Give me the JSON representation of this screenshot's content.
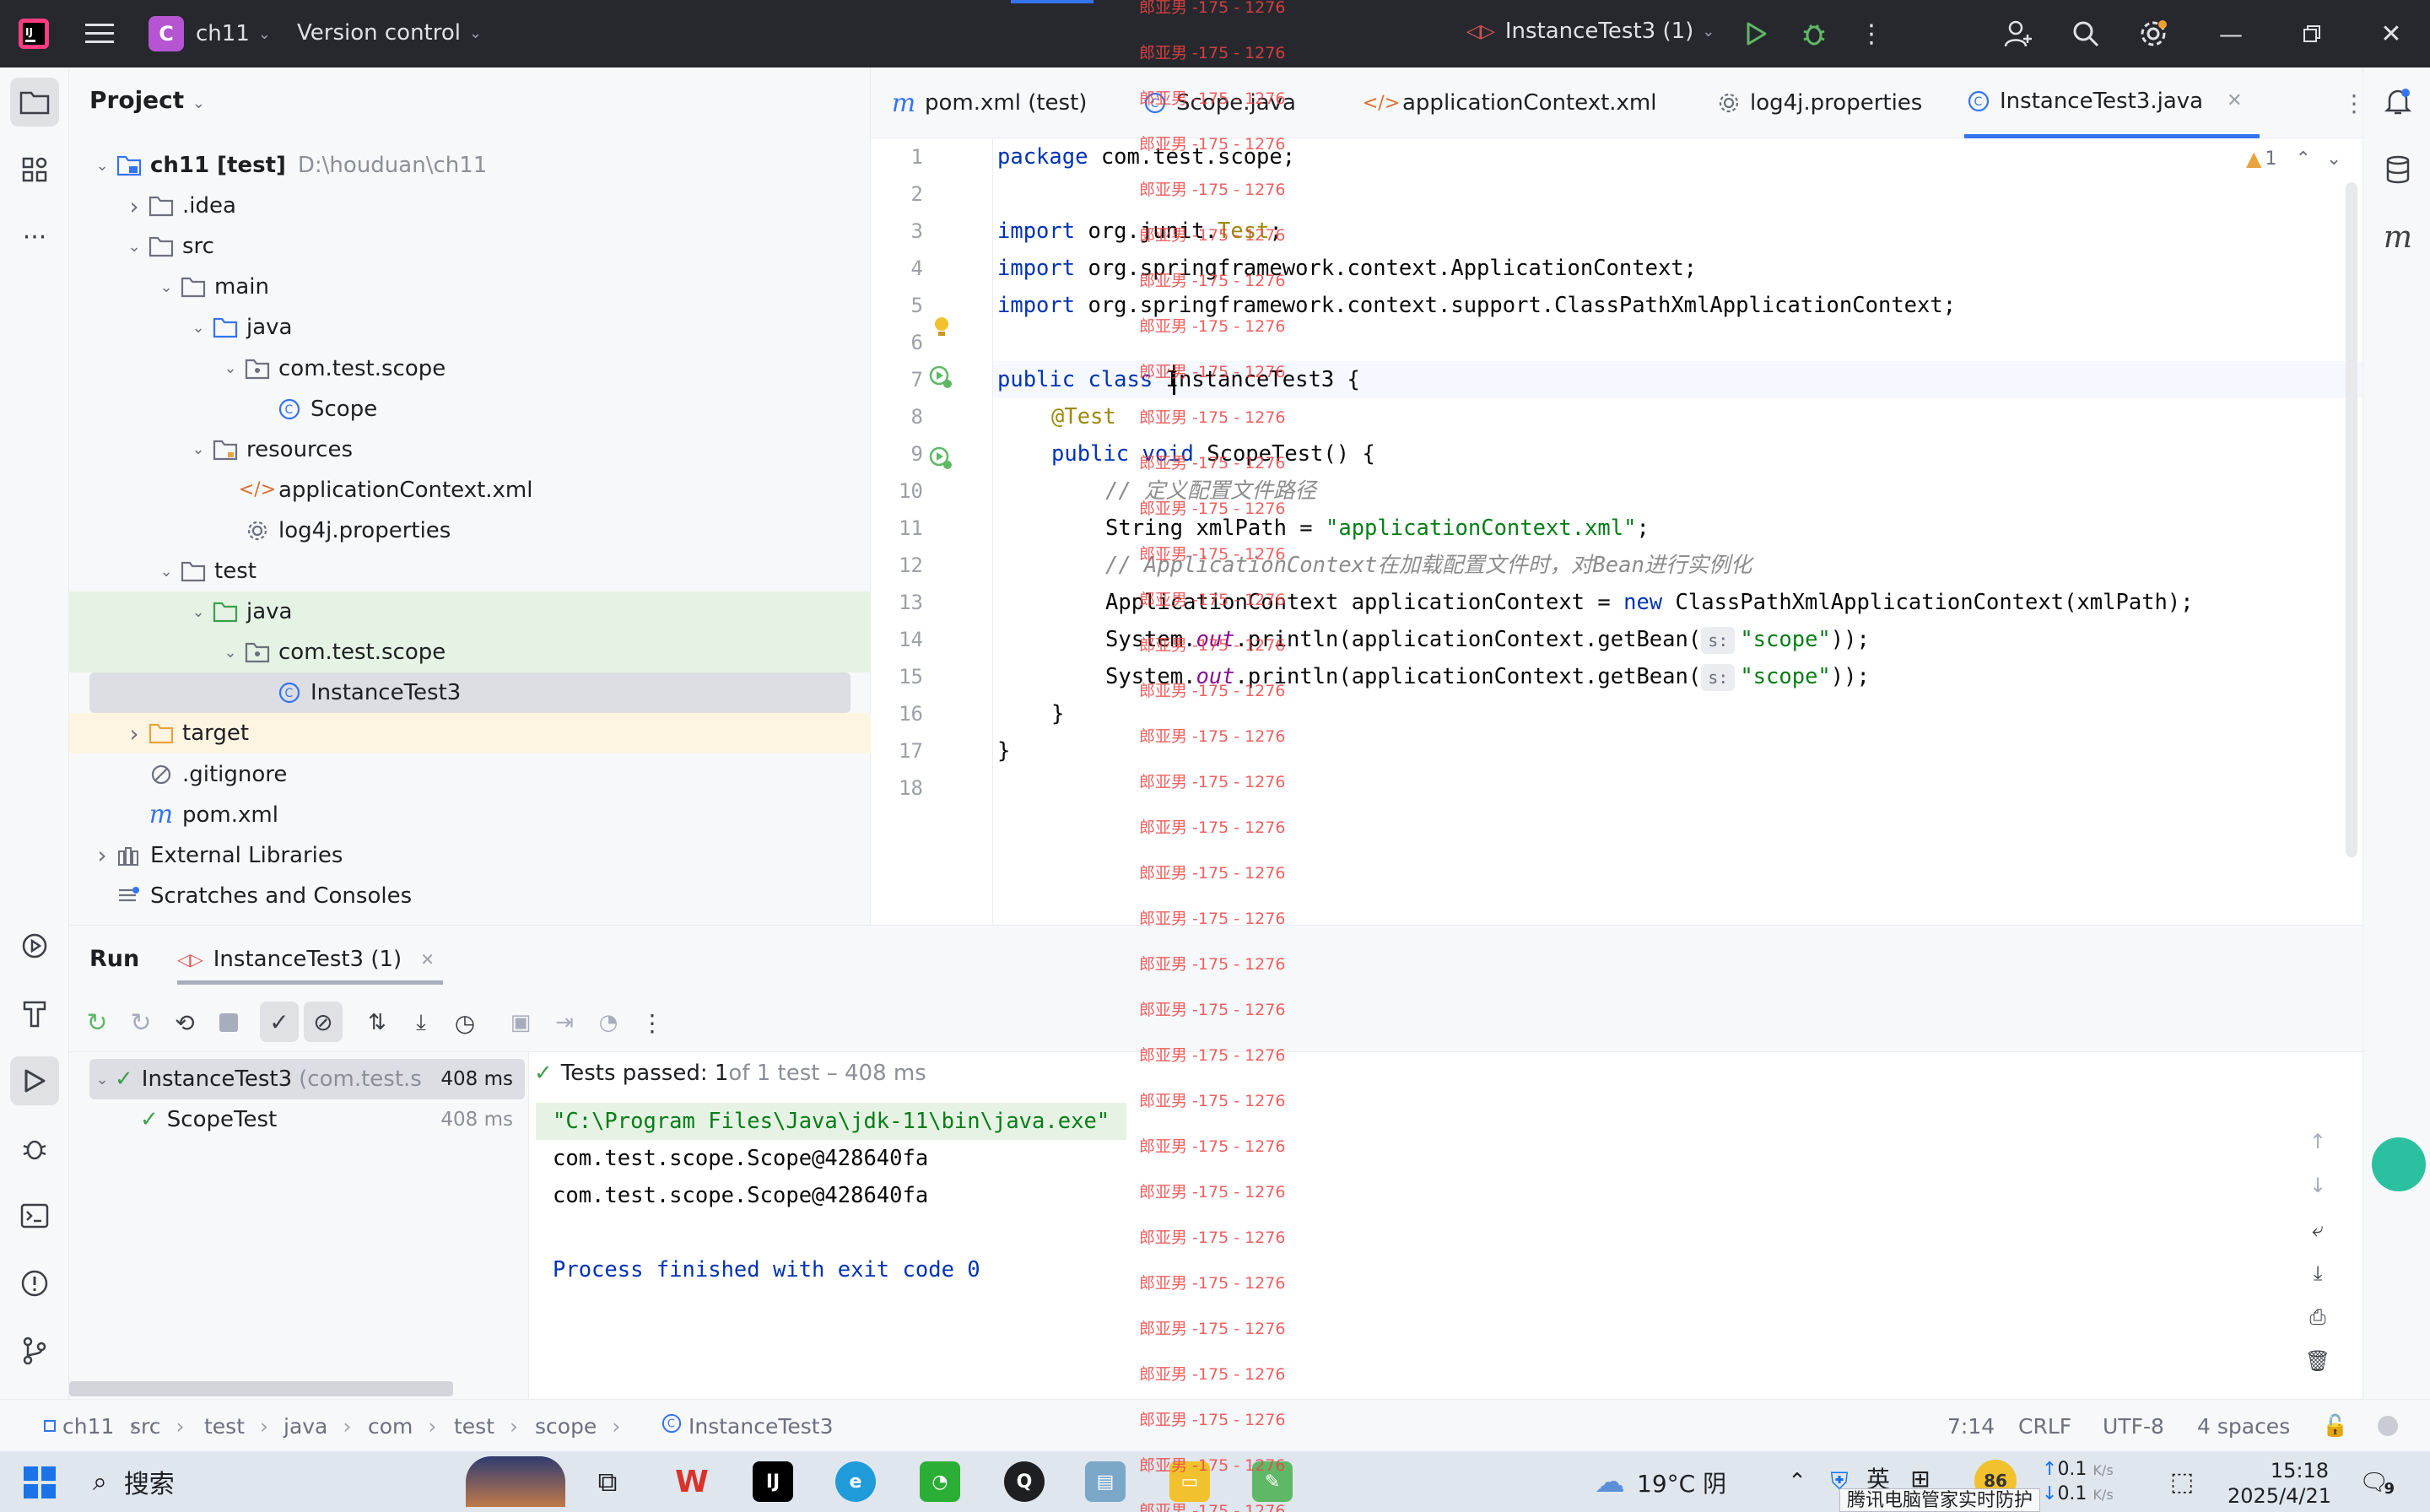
{
  "titlebar": {
    "project_badge": "C",
    "project_name": "ch11",
    "vcs_label": "Version control",
    "run_config": "InstanceTest3 (1)"
  },
  "project_panel": {
    "title": "Project",
    "tree": [
      {
        "label": "ch11 [test]",
        "extra": "D:\\houduan\\ch11",
        "depth": 0,
        "icon": "module-folder-icon",
        "arrow": "down"
      },
      {
        "label": ".idea",
        "depth": 1,
        "icon": "folder-icon",
        "arrow": "right"
      },
      {
        "label": "src",
        "depth": 1,
        "icon": "folder-icon",
        "arrow": "down"
      },
      {
        "label": "main",
        "depth": 2,
        "icon": "folder-icon",
        "arrow": "down"
      },
      {
        "label": "java",
        "depth": 3,
        "icon": "source-folder-icon",
        "arrow": "down"
      },
      {
        "label": "com.test.scope",
        "depth": 4,
        "icon": "package-icon",
        "arrow": "down"
      },
      {
        "label": "Scope",
        "depth": 5,
        "icon": "class-icon",
        "arrow": ""
      },
      {
        "label": "resources",
        "depth": 3,
        "icon": "resources-folder-icon",
        "arrow": "down"
      },
      {
        "label": "applicationContext.xml",
        "depth": 4,
        "icon": "xml-file-icon",
        "arrow": ""
      },
      {
        "label": "log4j.properties",
        "depth": 4,
        "icon": "properties-file-icon",
        "arrow": ""
      },
      {
        "label": "test",
        "depth": 2,
        "icon": "folder-icon",
        "arrow": "down"
      },
      {
        "label": "java",
        "depth": 3,
        "icon": "test-folder-icon",
        "arrow": "down"
      },
      {
        "label": "com.test.scope",
        "depth": 4,
        "icon": "package-icon",
        "arrow": "down"
      },
      {
        "label": "InstanceTest3",
        "depth": 5,
        "icon": "class-icon",
        "arrow": ""
      },
      {
        "label": "target",
        "depth": 1,
        "icon": "excluded-folder-icon",
        "arrow": "right"
      },
      {
        "label": ".gitignore",
        "depth": 1,
        "icon": "ignore-file-icon",
        "arrow": ""
      },
      {
        "label": "pom.xml",
        "depth": 1,
        "icon": "maven-icon",
        "arrow": ""
      },
      {
        "label": "External Libraries",
        "depth": 0,
        "icon": "library-icon",
        "arrow": "right"
      },
      {
        "label": "Scratches and Consoles",
        "depth": 0,
        "icon": "scratches-icon",
        "arrow": ""
      }
    ]
  },
  "editor": {
    "tabs": [
      {
        "label": "pom.xml (test)",
        "icon": "maven-icon"
      },
      {
        "label": "Scope.java",
        "icon": "class-icon"
      },
      {
        "label": "applicationContext.xml",
        "icon": "xml-file-icon"
      },
      {
        "label": "log4j.properties",
        "icon": "properties-file-icon"
      },
      {
        "label": "InstanceTest3.java",
        "icon": "class-icon",
        "active": true
      }
    ],
    "warning_count": "1",
    "line_numbers": [
      "1",
      "2",
      "3",
      "4",
      "5",
      "6",
      "7",
      "8",
      "9",
      "10",
      "11",
      "12",
      "13",
      "14",
      "15",
      "16",
      "17",
      "18"
    ],
    "code": {
      "l1_kw": "package",
      "l1_rest": " com.test.scope;",
      "l3_kw": "import",
      "l3_rest": " org.junit.",
      "l3_ann": "Test",
      "l3_end": ";",
      "l4_kw": "import",
      "l4_rest": " org.springframework.context.ApplicationContext;",
      "l5_kw": "import",
      "l5_rest": " org.springframework.context.support.ClassPathXmlApplicationContext;",
      "l7_kw": "public class",
      "l7_rest": " InstanceTest3 {",
      "l8_ann": "@Test",
      "l9_kw": "public void",
      "l9_rest": " ScopeTest() {",
      "l10_cm": "// 定义配置文件路径",
      "l11_a": "String xmlPath = ",
      "l11_str": "\"applicationContext.xml\"",
      "l11_end": ";",
      "l12_cm": "// ApplicationContext在加载配置文件时，对Bean进行实例化",
      "l13_a": "ApplicationContext applicationContext = ",
      "l13_kw": "new",
      "l13_rest": " ClassPathXmlApplicationContext(xmlPath);",
      "l14_a": "System.",
      "l14_fld": "out",
      "l14_b": ".println(applicationContext.getBean(",
      "l14_hint": "s:",
      "l14_str": "\"scope\"",
      "l14_end": "));",
      "l15_a": "System.",
      "l15_fld": "out",
      "l15_b": ".println(applicationContext.getBean(",
      "l15_hint": "s:",
      "l15_str": "\"scope\"",
      "l15_end": "));",
      "l16": "}",
      "l17": "}"
    }
  },
  "run_panel": {
    "title": "Run",
    "tab_label": "InstanceTest3 (1)",
    "tests": [
      {
        "name": "InstanceTest3",
        "extra": "(com.test.s",
        "time": "408 ms"
      },
      {
        "name": "ScopeTest",
        "time": "408 ms"
      }
    ],
    "summary_passed": "Tests passed: 1",
    "summary_rest": " of 1 test – 408 ms",
    "console": [
      "\"C:\\Program Files\\Java\\jdk-11\\bin\\java.exe\"",
      "com.test.scope.Scope@428640fa",
      "com.test.scope.Scope@428640fa",
      "",
      "Process finished with exit code 0"
    ]
  },
  "statusbar": {
    "breadcrumbs": [
      "ch11",
      "src",
      "test",
      "java",
      "com",
      "test",
      "scope",
      "InstanceTest3"
    ],
    "position": "7:14",
    "line_sep": "CRLF",
    "encoding": "UTF-8",
    "indent": "4 spaces"
  },
  "taskbar": {
    "search": "搜索",
    "weather": "19°C 阴",
    "ime": "英",
    "battery": "86",
    "net_up": "0.1",
    "net_down": "0.1",
    "net_unit": "K/s",
    "time": "15:18",
    "date": "2025/4/21",
    "notif_count": "9",
    "tooltip": "腾讯电脑管家实时防护"
  },
  "watermark": "郎亚男 -175 - 1276",
  "colors": {
    "accent": "#3574f0",
    "run_green": "#4caf50",
    "badge_purple": "#b555d2"
  }
}
